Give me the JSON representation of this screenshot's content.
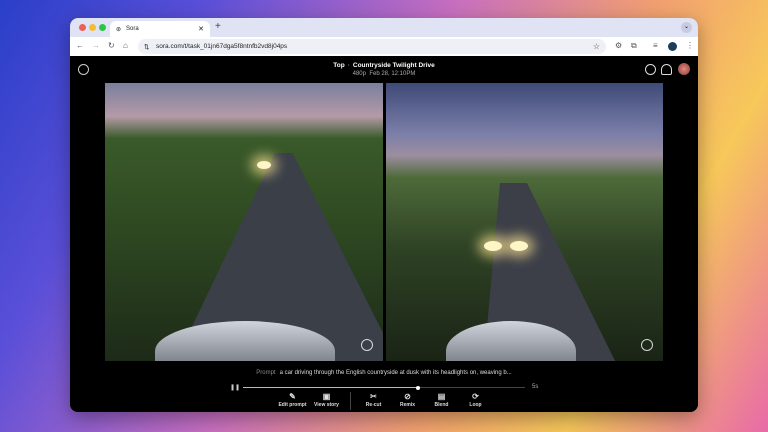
{
  "browser": {
    "tab_title": "Sora",
    "url": "sora.com/t/task_01jn67dga5f8ntnfb2vd8j04ps"
  },
  "header": {
    "breadcrumb_root": "Top",
    "title": "Countryside Twilight Drive",
    "resolution": "480p",
    "date": "Feb 28, 12:10PM"
  },
  "prompt": {
    "label": "Prompt",
    "text": "a car driving through the English countryside at dusk with its headlights on, weaving b..."
  },
  "player": {
    "duration": "5s",
    "progress": 0.62
  },
  "actions": [
    {
      "label": "Edit prompt",
      "icon": "✎"
    },
    {
      "label": "View story",
      "icon": "▣"
    },
    {
      "label": "Re-cut",
      "icon": "✂"
    },
    {
      "label": "Remix",
      "icon": "⊘"
    },
    {
      "label": "Blend",
      "icon": "▤"
    },
    {
      "label": "Loop",
      "icon": "⟳"
    }
  ]
}
